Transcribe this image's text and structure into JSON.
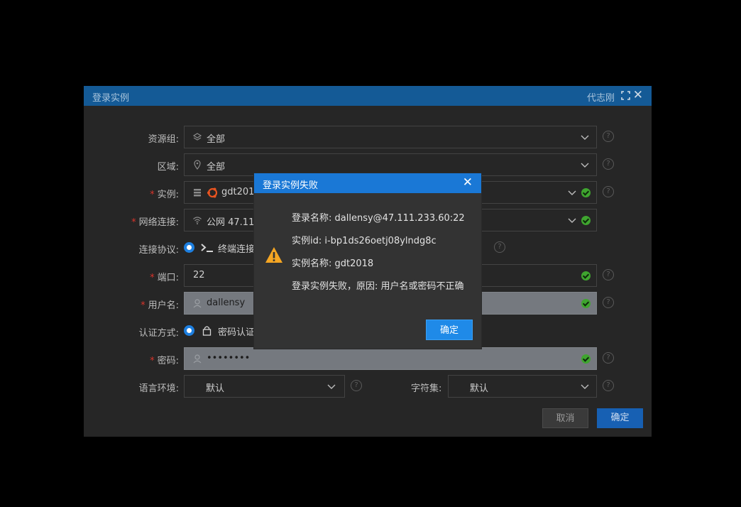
{
  "window": {
    "title": "登录实例",
    "user": "代志刚"
  },
  "form": {
    "resource_group": {
      "label": "资源组:",
      "value": "全部"
    },
    "region": {
      "label": "区域:",
      "value": "全部"
    },
    "instance": {
      "label": "实例:",
      "value": "gdt2018",
      "required": "*"
    },
    "network": {
      "label": "网络连接:",
      "value": "公网  47.111",
      "required": "*"
    },
    "protocol": {
      "label": "连接协议:",
      "value": "终端连接",
      "suffix": ")"
    },
    "port": {
      "label": "端口:",
      "value": "22",
      "required": "*"
    },
    "username": {
      "label": "用户名:",
      "value": "dallensy",
      "required": "*"
    },
    "auth": {
      "label": "认证方式:",
      "value": "密码认证"
    },
    "password": {
      "label": "密码:",
      "value": "••••••••",
      "required": "*"
    },
    "locale": {
      "label": "语言环境:",
      "value": "默认"
    },
    "charset": {
      "label": "字符集:",
      "value": "默认"
    },
    "help": "?",
    "cancel_label": "取消",
    "confirm_label": "确定"
  },
  "dialog": {
    "title": "登录实例失败",
    "close": "✕",
    "lines": [
      "登录名称: dallensy@47.111.233.60:22",
      "实例id: i-bp1ds26oetj08ylndg8c",
      "实例名称: gdt2018",
      "登录实例失败，原因: 用户名或密码不正确"
    ],
    "ok_label": "确定"
  },
  "colors": {
    "title_bar": "#145a96",
    "dialog_title": "#1a78d6",
    "primary": "#1760b3",
    "success": "#3fa52f",
    "warning": "#f5a623"
  }
}
